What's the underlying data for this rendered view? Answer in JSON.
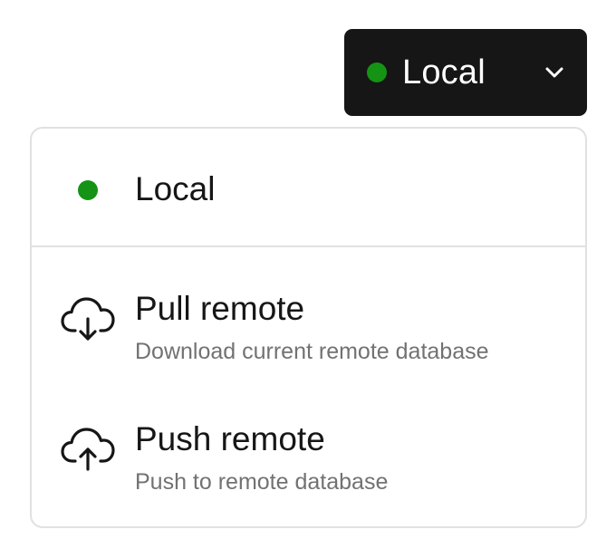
{
  "environment_button": {
    "label": "Local",
    "status_color": "#149314",
    "icon": "chevron-down-icon"
  },
  "menu": {
    "current": {
      "label": "Local",
      "status_color": "#149314"
    },
    "actions": [
      {
        "title": "Pull remote",
        "description": "Download current remote database",
        "icon": "cloud-download-icon"
      },
      {
        "title": "Push remote",
        "description": "Push to remote database",
        "icon": "cloud-upload-icon"
      }
    ]
  }
}
